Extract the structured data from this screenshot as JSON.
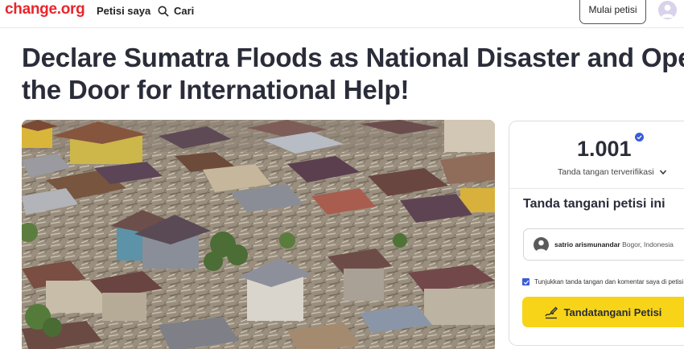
{
  "header": {
    "logo": "change.org",
    "nav_petisi": "Petisi saya",
    "nav_search": "Cari",
    "start_button": "Mulai petisi"
  },
  "petition": {
    "title_line1": "Declare Sumatra Floods as National Disaster and Open",
    "title_line2": "the Door for International Help!"
  },
  "sidebar": {
    "signature_count": "1.001",
    "verified_label": "Tanda tangan terverifikasi",
    "sign_heading": "Tanda tangani petisi ini",
    "signer_name": "satrio arismunandar",
    "signer_location": "Bogor, Indonesia",
    "consent_label": "Tunjukkan tanda tangan dan komentar saya di petisi",
    "consent_checked": true,
    "sign_button": "Tandatangani Petisi"
  },
  "colors": {
    "brand_red": "#e8262c",
    "cta_yellow": "#f7d417",
    "verified_blue": "#3a5bd9"
  },
  "icons": [
    "search-icon",
    "user-avatar-icon",
    "verified-badge-icon",
    "chevron-down-icon",
    "user-icon",
    "pencil-icon",
    "checkbox-icon",
    "signature-icon"
  ]
}
